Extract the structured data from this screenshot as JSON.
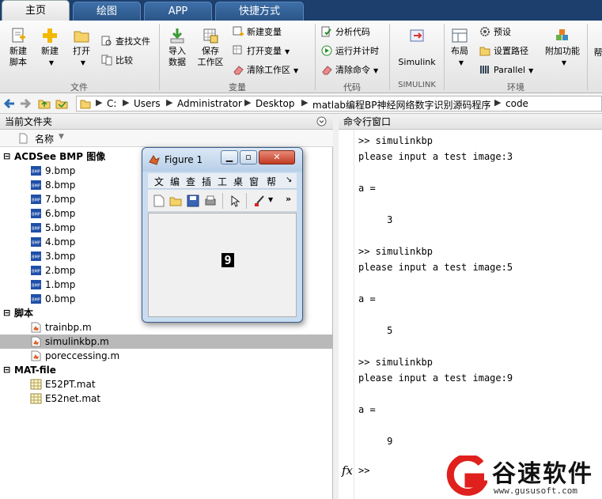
{
  "tabs": [
    {
      "label": "主页",
      "active": true
    },
    {
      "label": "绘图",
      "active": false
    },
    {
      "label": "APP",
      "active": false
    },
    {
      "label": "快捷方式",
      "active": false
    }
  ],
  "ribbon": {
    "file": {
      "new_script": "新建\n脚本",
      "new": "新建",
      "open": "打开",
      "find_files": "查找文件",
      "compare": "比较",
      "group_label": "文件"
    },
    "variable": {
      "import": "导入\n数据",
      "save": "保存\n工作区",
      "new_var": "新建变量",
      "open_var": "打开变量",
      "clear_ws": "清除工作区",
      "group_label": "变量"
    },
    "code": {
      "analyze": "分析代码",
      "run_time": "运行并计时",
      "clear_cmd": "清除命令",
      "group_label": "代码"
    },
    "simulink": {
      "label": "Simulink",
      "group_label": "SIMULINK"
    },
    "environment": {
      "layout": "布局",
      "prefs": "预设",
      "set_path": "设置路径",
      "parallel": "Parallel",
      "addons": "附加功能",
      "group_label": "环境"
    },
    "help_partial": "帮"
  },
  "address": {
    "crumbs": [
      "C:",
      "Users",
      "Administrator",
      "Desktop",
      "matlab编程BP神经网络数字识别源码程序",
      "code"
    ]
  },
  "current_folder": {
    "title": "当前文件夹",
    "column_name": "名称",
    "groups": [
      {
        "label": "ACDSee BMP 图像",
        "type": "bmp",
        "items": [
          "9.bmp",
          "8.bmp",
          "7.bmp",
          "6.bmp",
          "5.bmp",
          "4.bmp",
          "3.bmp",
          "2.bmp",
          "1.bmp",
          "0.bmp"
        ]
      },
      {
        "label": "脚本",
        "type": "m",
        "items": [
          "trainbp.m",
          "simulinkbp.m",
          "poreccessing.m"
        ]
      },
      {
        "label": "MAT-file",
        "type": "mat",
        "items": [
          "E52PT.mat",
          "E52net.mat"
        ]
      }
    ],
    "selected": "simulinkbp.m"
  },
  "command_window": {
    "title": "命令行窗口",
    "lines": [
      ">> simulinkbp",
      "please input a test image:3",
      "",
      "a =",
      "",
      "     3",
      "",
      ">> simulinkbp",
      "please input a test image:5",
      "",
      "a =",
      "",
      "     5",
      "",
      ">> simulinkbp",
      "please input a test image:9",
      "",
      "a =",
      "",
      "     9",
      ""
    ],
    "prompt": ">>",
    "fx": "fx"
  },
  "figure": {
    "title": "Figure 1",
    "menu": [
      "文",
      "编",
      "查",
      "插",
      "工",
      "桌",
      "窗",
      "帮"
    ],
    "digit": "9"
  },
  "watermark": {
    "name": "谷速软件",
    "url": "www.gususoft.com"
  },
  "colors": {
    "tabbar": "#1c3f6e",
    "selected_row": "#b9b9b9",
    "watermark_red": "#e0201c"
  }
}
